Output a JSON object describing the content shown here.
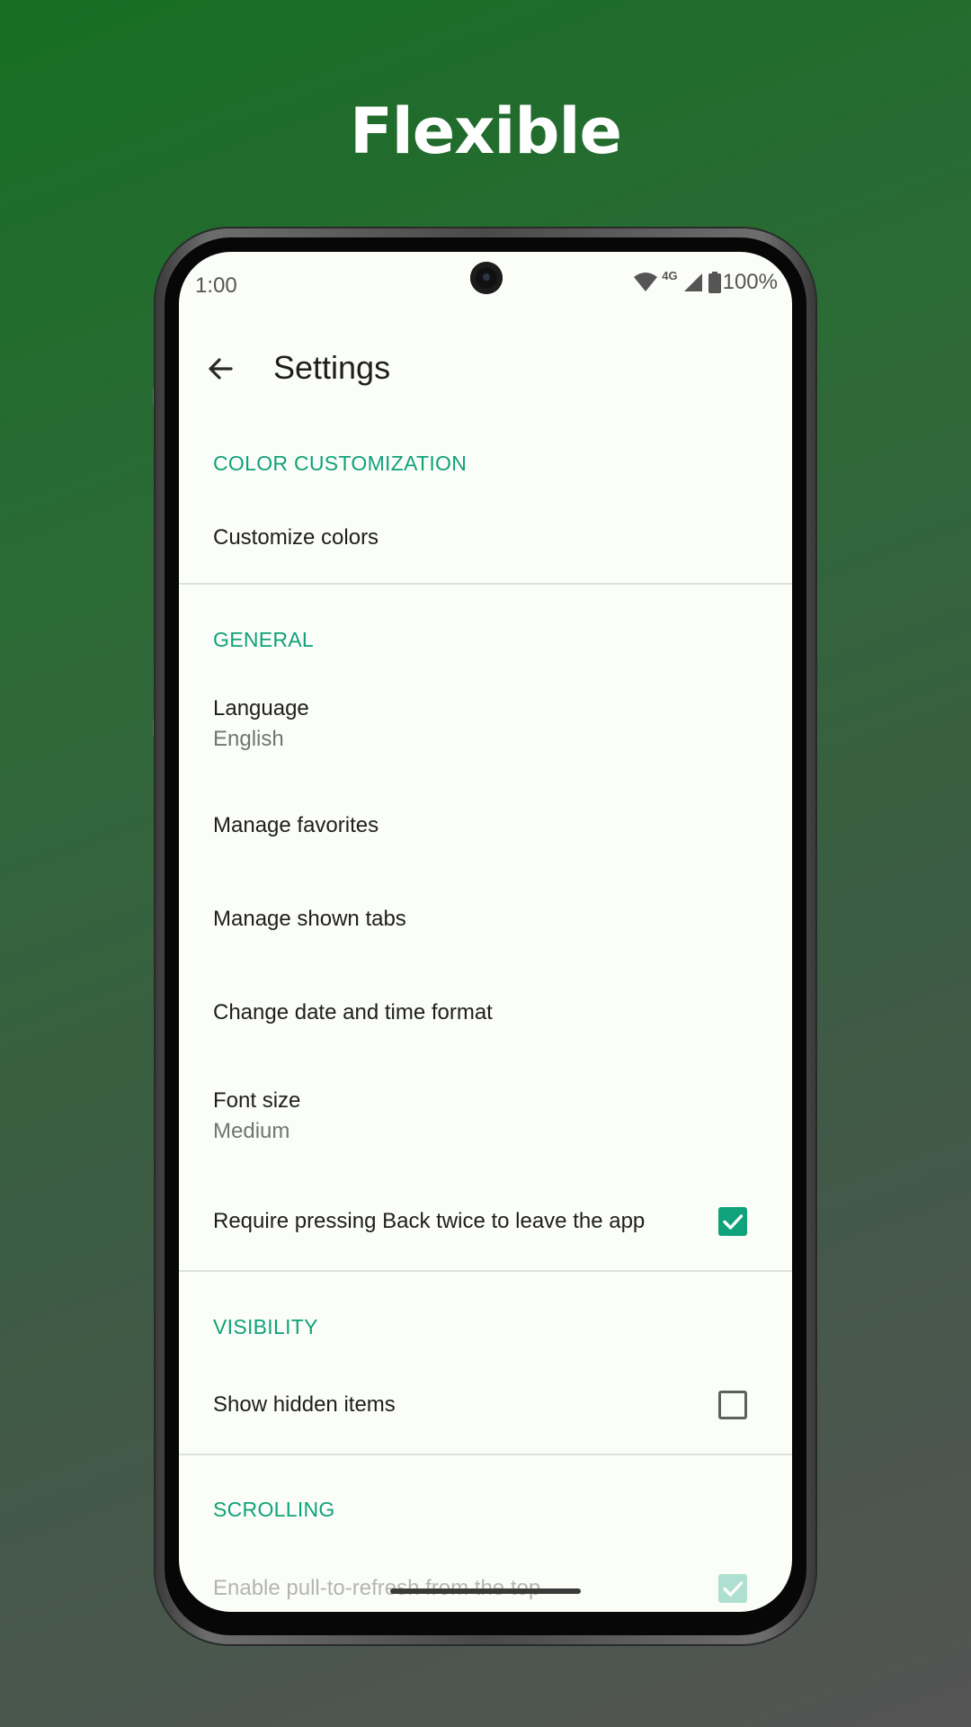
{
  "headline": "Flexible",
  "status_bar": {
    "time": "1:00",
    "network": "4G",
    "battery": "100%"
  },
  "toolbar": {
    "title": "Settings",
    "back_icon": "arrow-back-icon"
  },
  "sections": {
    "color": {
      "header": "COLOR CUSTOMIZATION",
      "customize_colors": "Customize colors"
    },
    "general": {
      "header": "GENERAL",
      "language_title": "Language",
      "language_value": "English",
      "manage_favorites": "Manage favorites",
      "manage_tabs": "Manage shown tabs",
      "date_format": "Change date and time format",
      "font_size_title": "Font size",
      "font_size_value": "Medium",
      "press_back_twice": "Require pressing Back twice to leave the app",
      "press_back_twice_checked": true
    },
    "visibility": {
      "header": "VISIBILITY",
      "show_hidden": "Show hidden items",
      "show_hidden_checked": false
    },
    "scrolling": {
      "header": "SCROLLING",
      "pull_to_refresh": "Enable pull-to-refresh from the top",
      "pull_to_refresh_checked": true
    }
  },
  "colors": {
    "accent": "#10a27a",
    "background": "#fbfdf9"
  }
}
